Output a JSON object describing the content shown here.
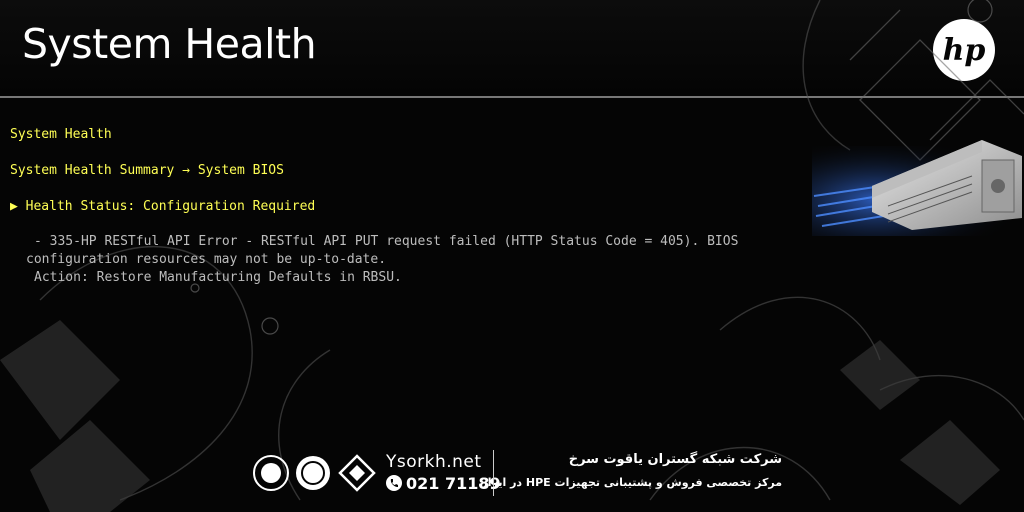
{
  "header": {
    "title": "System Health",
    "logo_text": "hp"
  },
  "content": {
    "heading": "System Health",
    "breadcrumb": "System Health Summary → System BIOS",
    "status_arrow": "▶",
    "status": "Health Status: Configuration Required",
    "message_lines": [
      "- 335-HP RESTful API Error - RESTful API PUT request failed (HTTP Status Code = 405). BIOS",
      "configuration resources may not be up-to-date.",
      "Action: Restore Manufacturing Defaults in RBSU."
    ]
  },
  "watermark": {
    "site": "Ysorkh.net",
    "phone": "021 71189",
    "company": "شرکت شبکه گستران یاقوت سرخ",
    "tagline": "مرکز تخصصی فروش و پشتیبانی تجهیزات HPE در ایران"
  },
  "colors": {
    "bios_text": "#ffff55",
    "detail_text": "#bdbdbd",
    "background": "#050505"
  }
}
